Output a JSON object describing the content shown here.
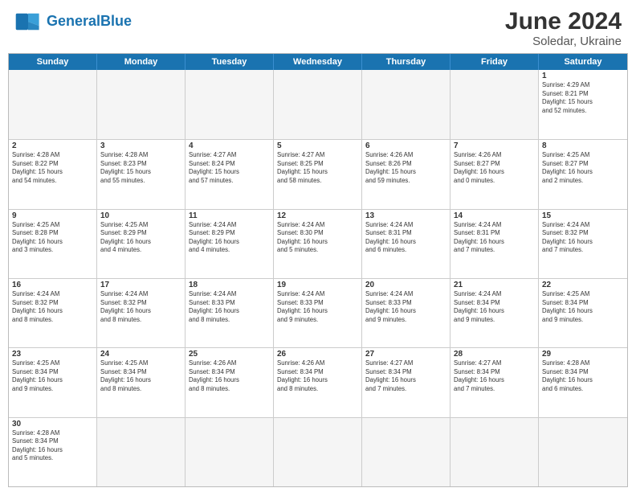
{
  "header": {
    "logo_general": "General",
    "logo_blue": "Blue",
    "title": "June 2024",
    "location": "Soledar, Ukraine"
  },
  "days_of_week": [
    "Sunday",
    "Monday",
    "Tuesday",
    "Wednesday",
    "Thursday",
    "Friday",
    "Saturday"
  ],
  "weeks": [
    [
      {
        "day": "",
        "info": "",
        "empty": true
      },
      {
        "day": "",
        "info": "",
        "empty": true
      },
      {
        "day": "",
        "info": "",
        "empty": true
      },
      {
        "day": "",
        "info": "",
        "empty": true
      },
      {
        "day": "",
        "info": "",
        "empty": true
      },
      {
        "day": "",
        "info": "",
        "empty": true
      },
      {
        "day": "1",
        "info": "Sunrise: 4:29 AM\nSunset: 8:21 PM\nDaylight: 15 hours\nand 52 minutes.",
        "empty": false
      }
    ],
    [
      {
        "day": "2",
        "info": "Sunrise: 4:28 AM\nSunset: 8:22 PM\nDaylight: 15 hours\nand 54 minutes.",
        "empty": false
      },
      {
        "day": "3",
        "info": "Sunrise: 4:28 AM\nSunset: 8:23 PM\nDaylight: 15 hours\nand 55 minutes.",
        "empty": false
      },
      {
        "day": "4",
        "info": "Sunrise: 4:27 AM\nSunset: 8:24 PM\nDaylight: 15 hours\nand 57 minutes.",
        "empty": false
      },
      {
        "day": "5",
        "info": "Sunrise: 4:27 AM\nSunset: 8:25 PM\nDaylight: 15 hours\nand 58 minutes.",
        "empty": false
      },
      {
        "day": "6",
        "info": "Sunrise: 4:26 AM\nSunset: 8:26 PM\nDaylight: 15 hours\nand 59 minutes.",
        "empty": false
      },
      {
        "day": "7",
        "info": "Sunrise: 4:26 AM\nSunset: 8:27 PM\nDaylight: 16 hours\nand 0 minutes.",
        "empty": false
      },
      {
        "day": "8",
        "info": "Sunrise: 4:25 AM\nSunset: 8:27 PM\nDaylight: 16 hours\nand 2 minutes.",
        "empty": false
      }
    ],
    [
      {
        "day": "9",
        "info": "Sunrise: 4:25 AM\nSunset: 8:28 PM\nDaylight: 16 hours\nand 3 minutes.",
        "empty": false
      },
      {
        "day": "10",
        "info": "Sunrise: 4:25 AM\nSunset: 8:29 PM\nDaylight: 16 hours\nand 4 minutes.",
        "empty": false
      },
      {
        "day": "11",
        "info": "Sunrise: 4:24 AM\nSunset: 8:29 PM\nDaylight: 16 hours\nand 4 minutes.",
        "empty": false
      },
      {
        "day": "12",
        "info": "Sunrise: 4:24 AM\nSunset: 8:30 PM\nDaylight: 16 hours\nand 5 minutes.",
        "empty": false
      },
      {
        "day": "13",
        "info": "Sunrise: 4:24 AM\nSunset: 8:31 PM\nDaylight: 16 hours\nand 6 minutes.",
        "empty": false
      },
      {
        "day": "14",
        "info": "Sunrise: 4:24 AM\nSunset: 8:31 PM\nDaylight: 16 hours\nand 7 minutes.",
        "empty": false
      },
      {
        "day": "15",
        "info": "Sunrise: 4:24 AM\nSunset: 8:32 PM\nDaylight: 16 hours\nand 7 minutes.",
        "empty": false
      }
    ],
    [
      {
        "day": "16",
        "info": "Sunrise: 4:24 AM\nSunset: 8:32 PM\nDaylight: 16 hours\nand 8 minutes.",
        "empty": false
      },
      {
        "day": "17",
        "info": "Sunrise: 4:24 AM\nSunset: 8:32 PM\nDaylight: 16 hours\nand 8 minutes.",
        "empty": false
      },
      {
        "day": "18",
        "info": "Sunrise: 4:24 AM\nSunset: 8:33 PM\nDaylight: 16 hours\nand 8 minutes.",
        "empty": false
      },
      {
        "day": "19",
        "info": "Sunrise: 4:24 AM\nSunset: 8:33 PM\nDaylight: 16 hours\nand 9 minutes.",
        "empty": false
      },
      {
        "day": "20",
        "info": "Sunrise: 4:24 AM\nSunset: 8:33 PM\nDaylight: 16 hours\nand 9 minutes.",
        "empty": false
      },
      {
        "day": "21",
        "info": "Sunrise: 4:24 AM\nSunset: 8:34 PM\nDaylight: 16 hours\nand 9 minutes.",
        "empty": false
      },
      {
        "day": "22",
        "info": "Sunrise: 4:25 AM\nSunset: 8:34 PM\nDaylight: 16 hours\nand 9 minutes.",
        "empty": false
      }
    ],
    [
      {
        "day": "23",
        "info": "Sunrise: 4:25 AM\nSunset: 8:34 PM\nDaylight: 16 hours\nand 9 minutes.",
        "empty": false
      },
      {
        "day": "24",
        "info": "Sunrise: 4:25 AM\nSunset: 8:34 PM\nDaylight: 16 hours\nand 8 minutes.",
        "empty": false
      },
      {
        "day": "25",
        "info": "Sunrise: 4:26 AM\nSunset: 8:34 PM\nDaylight: 16 hours\nand 8 minutes.",
        "empty": false
      },
      {
        "day": "26",
        "info": "Sunrise: 4:26 AM\nSunset: 8:34 PM\nDaylight: 16 hours\nand 8 minutes.",
        "empty": false
      },
      {
        "day": "27",
        "info": "Sunrise: 4:27 AM\nSunset: 8:34 PM\nDaylight: 16 hours\nand 7 minutes.",
        "empty": false
      },
      {
        "day": "28",
        "info": "Sunrise: 4:27 AM\nSunset: 8:34 PM\nDaylight: 16 hours\nand 7 minutes.",
        "empty": false
      },
      {
        "day": "29",
        "info": "Sunrise: 4:28 AM\nSunset: 8:34 PM\nDaylight: 16 hours\nand 6 minutes.",
        "empty": false
      }
    ],
    [
      {
        "day": "30",
        "info": "Sunrise: 4:28 AM\nSunset: 8:34 PM\nDaylight: 16 hours\nand 5 minutes.",
        "empty": false
      },
      {
        "day": "",
        "info": "",
        "empty": true
      },
      {
        "day": "",
        "info": "",
        "empty": true
      },
      {
        "day": "",
        "info": "",
        "empty": true
      },
      {
        "day": "",
        "info": "",
        "empty": true
      },
      {
        "day": "",
        "info": "",
        "empty": true
      },
      {
        "day": "",
        "info": "",
        "empty": true
      }
    ]
  ]
}
